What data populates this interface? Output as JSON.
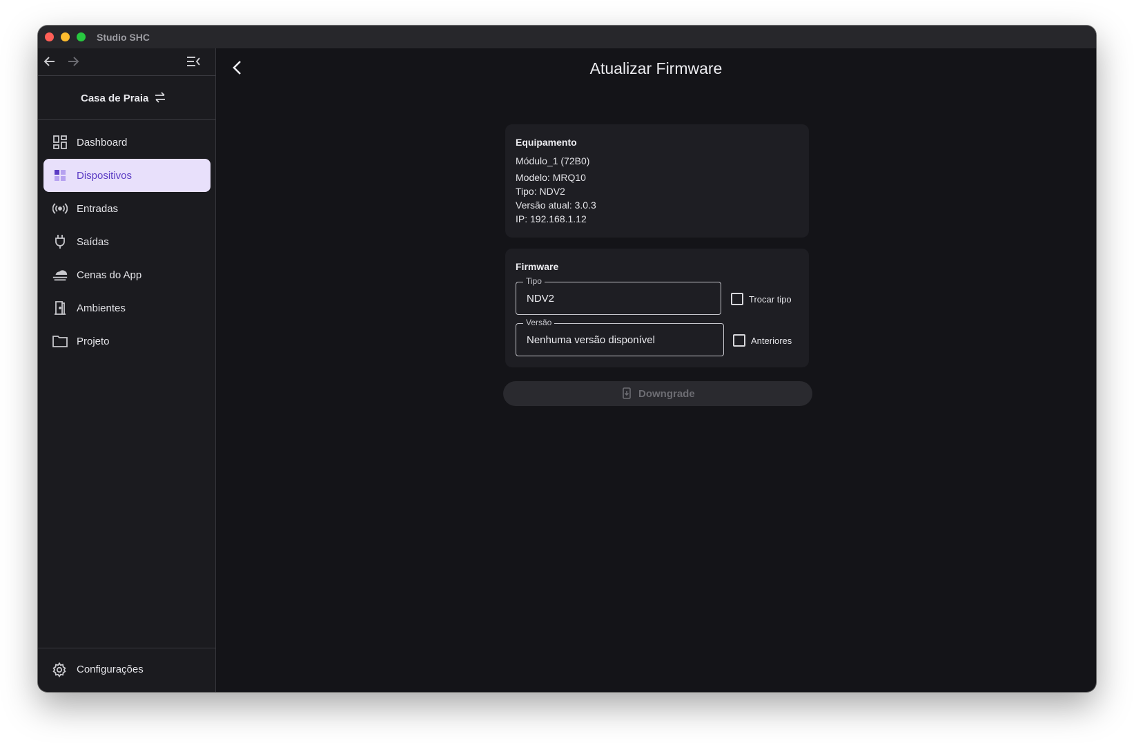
{
  "window": {
    "title": "Studio SHC"
  },
  "sidebar": {
    "project_name": "Casa de Praia",
    "items": [
      {
        "label": "Dashboard",
        "icon": "dashboard-icon"
      },
      {
        "label": "Dispositivos",
        "icon": "devices-icon",
        "active": true
      },
      {
        "label": "Entradas",
        "icon": "inputs-broadcast-icon"
      },
      {
        "label": "Saídas",
        "icon": "outputs-plug-icon"
      },
      {
        "label": "Cenas do App",
        "icon": "scenes-cloud-icon"
      },
      {
        "label": "Ambientes",
        "icon": "rooms-door-icon"
      },
      {
        "label": "Projeto",
        "icon": "project-folder-icon"
      }
    ],
    "settings_label": "Configurações"
  },
  "main": {
    "title": "Atualizar Firmware",
    "equipment": {
      "title": "Equipamento",
      "name": "Módulo_1 (72B0)",
      "model": "Modelo: MRQ10",
      "type": "Tipo: NDV2",
      "version": "Versão atual: 3.0.3",
      "ip": "IP: 192.168.1.12"
    },
    "firmware": {
      "title": "Firmware",
      "type_label": "Tipo",
      "type_value": "NDV2",
      "change_type_label": "Trocar tipo",
      "change_type_checked": false,
      "version_label": "Versão",
      "version_value": "Nenhuma versão disponível",
      "previous_label": "Anteriores",
      "previous_checked": false
    },
    "action_button": "Downgrade"
  },
  "colors": {
    "accent": "#5b3cc4",
    "active_bg": "#e8e0fb",
    "background": "#141418",
    "card": "#1e1e23"
  }
}
